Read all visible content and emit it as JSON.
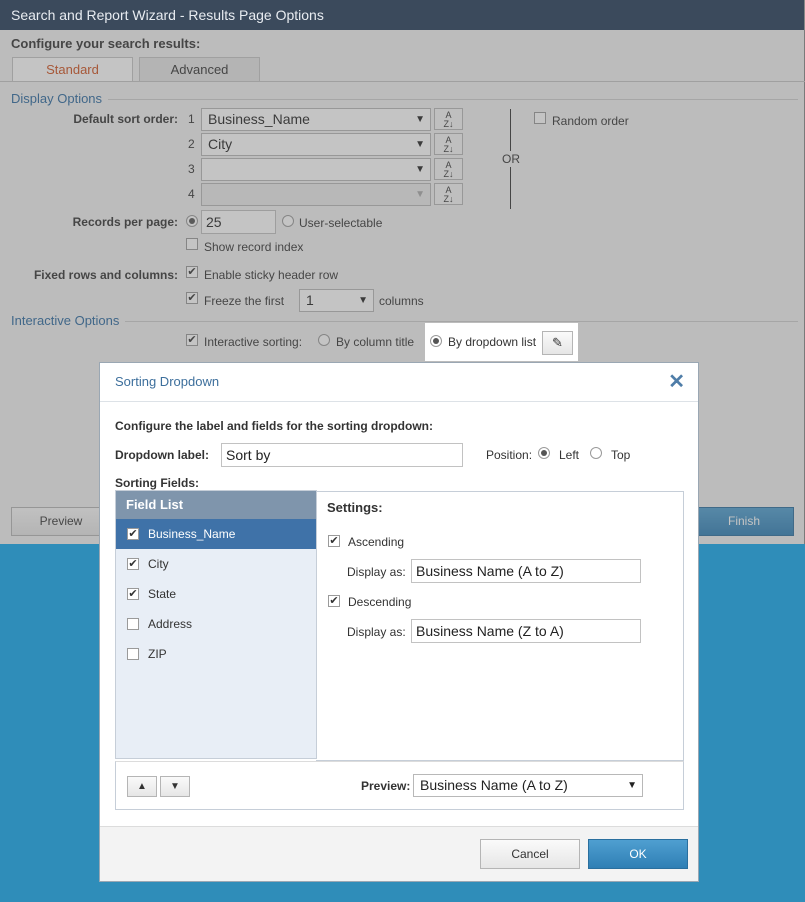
{
  "window": {
    "title": "Search and Report Wizard - Results Page Options"
  },
  "page": {
    "heading": "Configure your search results:",
    "tabs": [
      {
        "label": "Standard"
      },
      {
        "label": "Advanced"
      }
    ]
  },
  "display_options": {
    "title": "Display Options",
    "default_sort_label": "Default sort order:",
    "sort_rows": [
      {
        "num": "1",
        "value": "Business_Name"
      },
      {
        "num": "2",
        "value": "City"
      },
      {
        "num": "3",
        "value": ""
      },
      {
        "num": "4",
        "value": ""
      }
    ],
    "or_label": "OR",
    "random_order_label": "Random order",
    "records_label": "Records per page:",
    "records_value": "25",
    "user_selectable_label": "User-selectable",
    "show_index_label": "Show record index",
    "fixed_label": "Fixed rows and columns:",
    "sticky_label": "Enable sticky header row",
    "freeze_label": "Freeze the first",
    "freeze_value": "1",
    "columns_label": "columns"
  },
  "interactive_options": {
    "title": "Interactive Options",
    "sorting_label": "Interactive sorting:",
    "by_title_label": "By column title",
    "by_dropdown_label": "By dropdown list"
  },
  "wizard_footer": {
    "preview_label": "Preview",
    "finish_label": "Finish"
  },
  "dialog": {
    "title": "Sorting Dropdown",
    "intro": "Configure the label and fields for the sorting dropdown:",
    "dropdown_label_caption": "Dropdown label:",
    "dropdown_label_value": "Sort by",
    "position_label": "Position:",
    "position_left": "Left",
    "position_top": "Top",
    "sorting_fields_label": "Sorting Fields:",
    "field_list_header": "Field List",
    "fields": [
      {
        "label": "Business_Name",
        "checked": true
      },
      {
        "label": "City",
        "checked": true
      },
      {
        "label": "State",
        "checked": true
      },
      {
        "label": "Address",
        "checked": false
      },
      {
        "label": "ZIP",
        "checked": false
      }
    ],
    "settings_title": "Settings:",
    "ascending_label": "Ascending",
    "asc_display_label": "Display as:",
    "asc_display_value": "Business Name (A to Z)",
    "descending_label": "Descending",
    "desc_display_label": "Display as:",
    "desc_display_value": "Business Name (Z to A)",
    "preview_label": "Preview:",
    "preview_value": "Business Name (A to Z)",
    "cancel_label": "Cancel",
    "ok_label": "OK"
  }
}
